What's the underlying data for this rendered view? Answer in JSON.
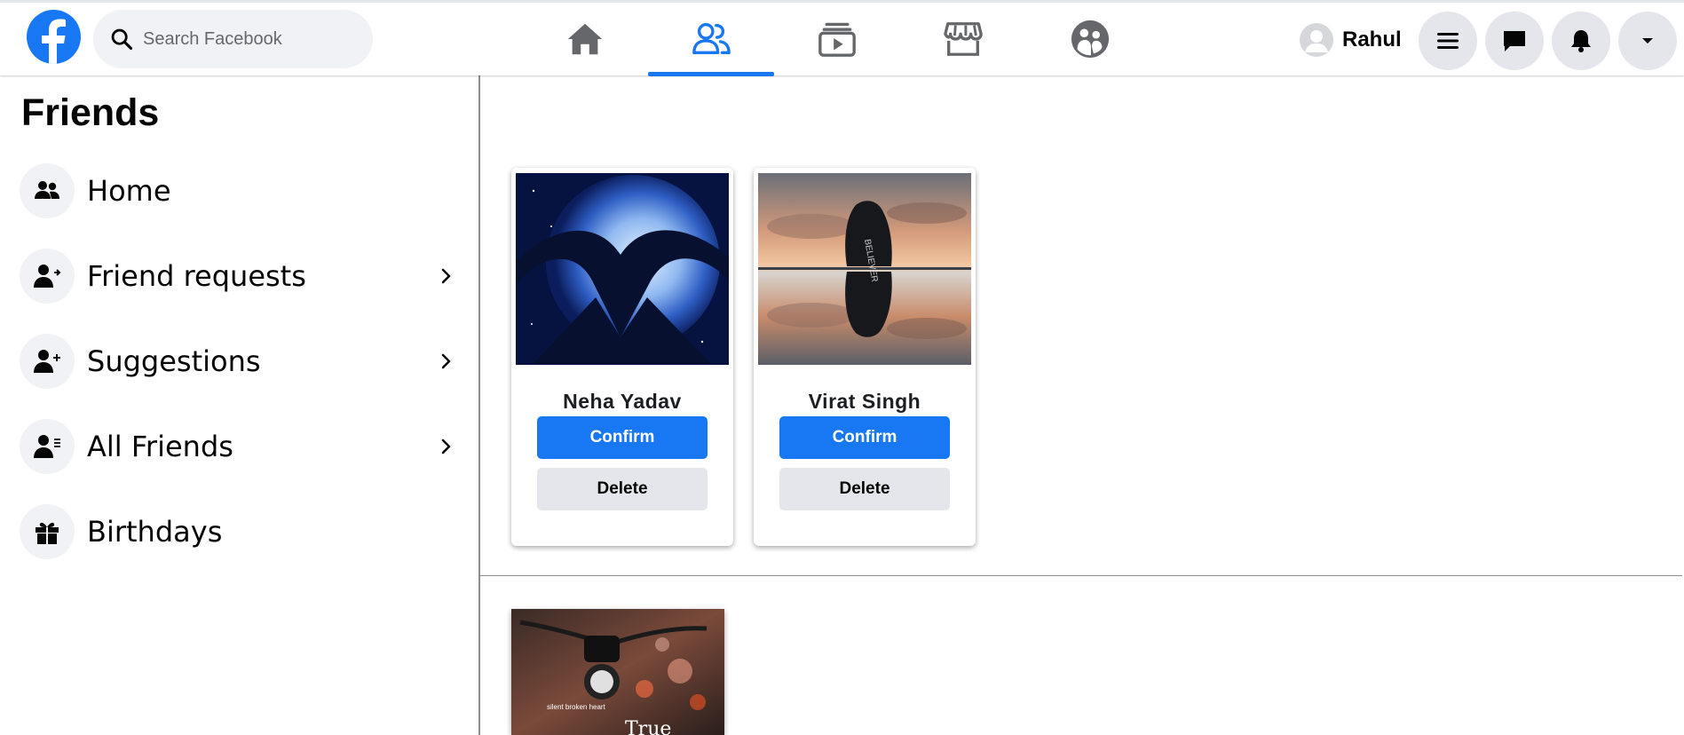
{
  "header": {
    "search_placeholder": "Search Facebook",
    "nav_tabs": [
      {
        "name": "home",
        "icon": "home-icon",
        "active": false
      },
      {
        "name": "friends",
        "icon": "friends-icon",
        "active": true
      },
      {
        "name": "watch",
        "icon": "watch-icon",
        "active": false
      },
      {
        "name": "marketplace",
        "icon": "marketplace-icon",
        "active": false
      },
      {
        "name": "groups",
        "icon": "groups-icon",
        "active": false
      }
    ],
    "profile_name": "Rahul",
    "buttons": [
      "menu-icon",
      "messenger-icon",
      "bell-icon",
      "caret-down-icon"
    ]
  },
  "sidebar": {
    "title": "Friends",
    "items": [
      {
        "label": "Home",
        "icon": "friends-home-icon",
        "chevron": false
      },
      {
        "label": "Friend requests",
        "icon": "friend-requests-icon",
        "chevron": true
      },
      {
        "label": "Suggestions",
        "icon": "suggestions-icon",
        "chevron": true
      },
      {
        "label": "All Friends",
        "icon": "all-friends-icon",
        "chevron": true
      },
      {
        "label": "Birthdays",
        "icon": "gift-icon",
        "chevron": false
      }
    ]
  },
  "main": {
    "requests": [
      {
        "name": "Neha Yadav",
        "confirm_label": "Confirm",
        "delete_label": "Delete",
        "photo": "heart-hands-moon"
      },
      {
        "name": "Virat Singh",
        "confirm_label": "Confirm",
        "delete_label": "Delete",
        "photo": "believer-reflection"
      }
    ],
    "partial_card": {
      "photo": "bicycle-bokeh",
      "photo_text": "True"
    }
  },
  "colors": {
    "brand": "#1877f2",
    "secondary_button": "#e4e6eb",
    "icon_gray": "#65676b"
  }
}
